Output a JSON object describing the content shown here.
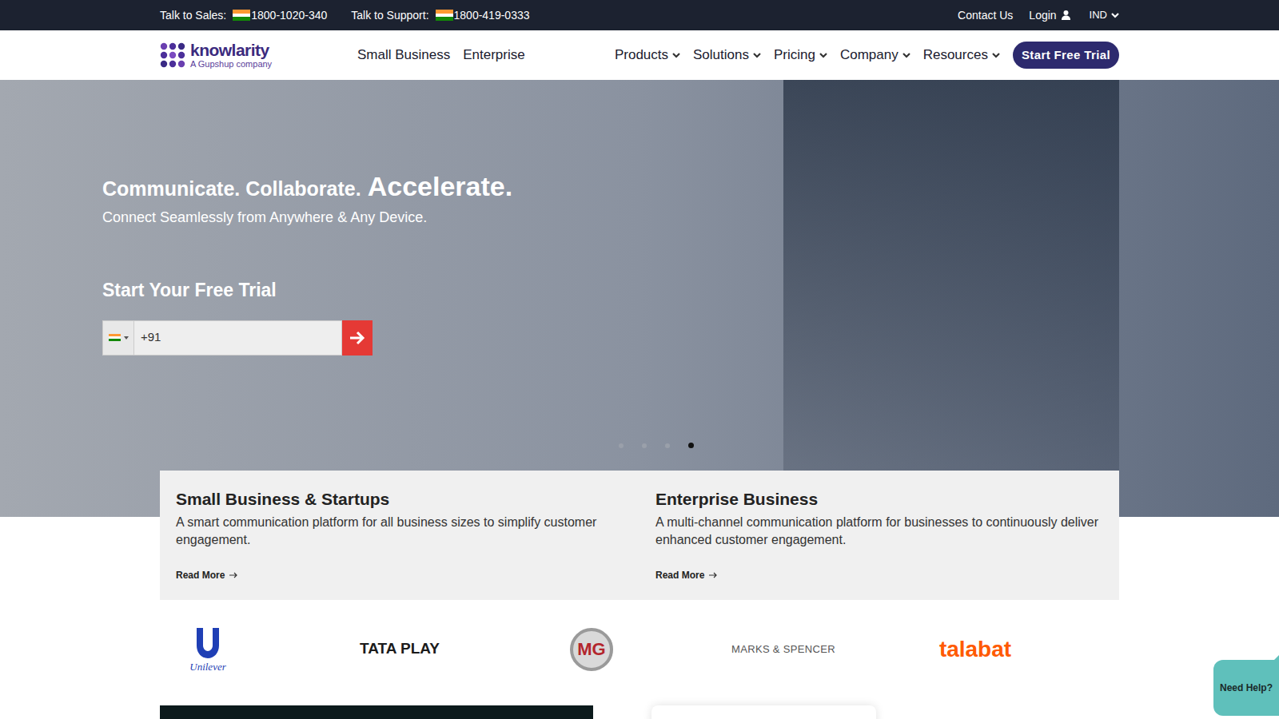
{
  "topbar": {
    "sales_label": "Talk to Sales:",
    "sales_phone": "1800-1020-340",
    "support_label": "Talk to Support:",
    "support_phone": "1800-419-0333",
    "links": [
      "Contact Us",
      "Login"
    ],
    "region": "IND"
  },
  "logo": {
    "name": "knowlarity",
    "tagline": "A Gupshup company"
  },
  "nav": {
    "segments": [
      "Small Business",
      "Enterprise"
    ],
    "menus": [
      "Products",
      "Solutions",
      "Pricing",
      "Company",
      "Resources"
    ],
    "cta": "Start Free Trial"
  },
  "hero": {
    "heading_lead": "Communicate. Collaborate.",
    "heading_accent": "Accelerate.",
    "subtitle": "Connect Seamlessly from Anywhere & Any Device.",
    "form_title": "Start Your Free Trial",
    "phone": {
      "value": "+91"
    },
    "slides": [
      {
        "selected": false
      },
      {
        "selected": false
      },
      {
        "selected": false
      },
      {
        "selected": true
      }
    ]
  },
  "cards": [
    {
      "title": "Small Business & Startups",
      "description": "A smart communication platform for all business sizes to simplify customer engagement.",
      "link": "Read More"
    },
    {
      "title": "Enterprise Business",
      "description": "A multi-channel communication platform for businesses to continuously deliver enhanced customer engagement.",
      "link": "Read More"
    }
  ],
  "clients": [
    {
      "name": "Unilever",
      "kind": "emblem",
      "color": "#1f3fb5"
    },
    {
      "name": "TATA PLAY",
      "kind": "wordmark",
      "color": "#1b1b1b"
    },
    {
      "name": "MG",
      "kind": "badge",
      "color": "#b3262d"
    },
    {
      "name": "MARKS & SPENCER",
      "kind": "caps",
      "color": "#555555"
    },
    {
      "name": "talabat",
      "kind": "wordmark",
      "color": "#ff5a00"
    }
  ],
  "help": "Need Help?"
}
